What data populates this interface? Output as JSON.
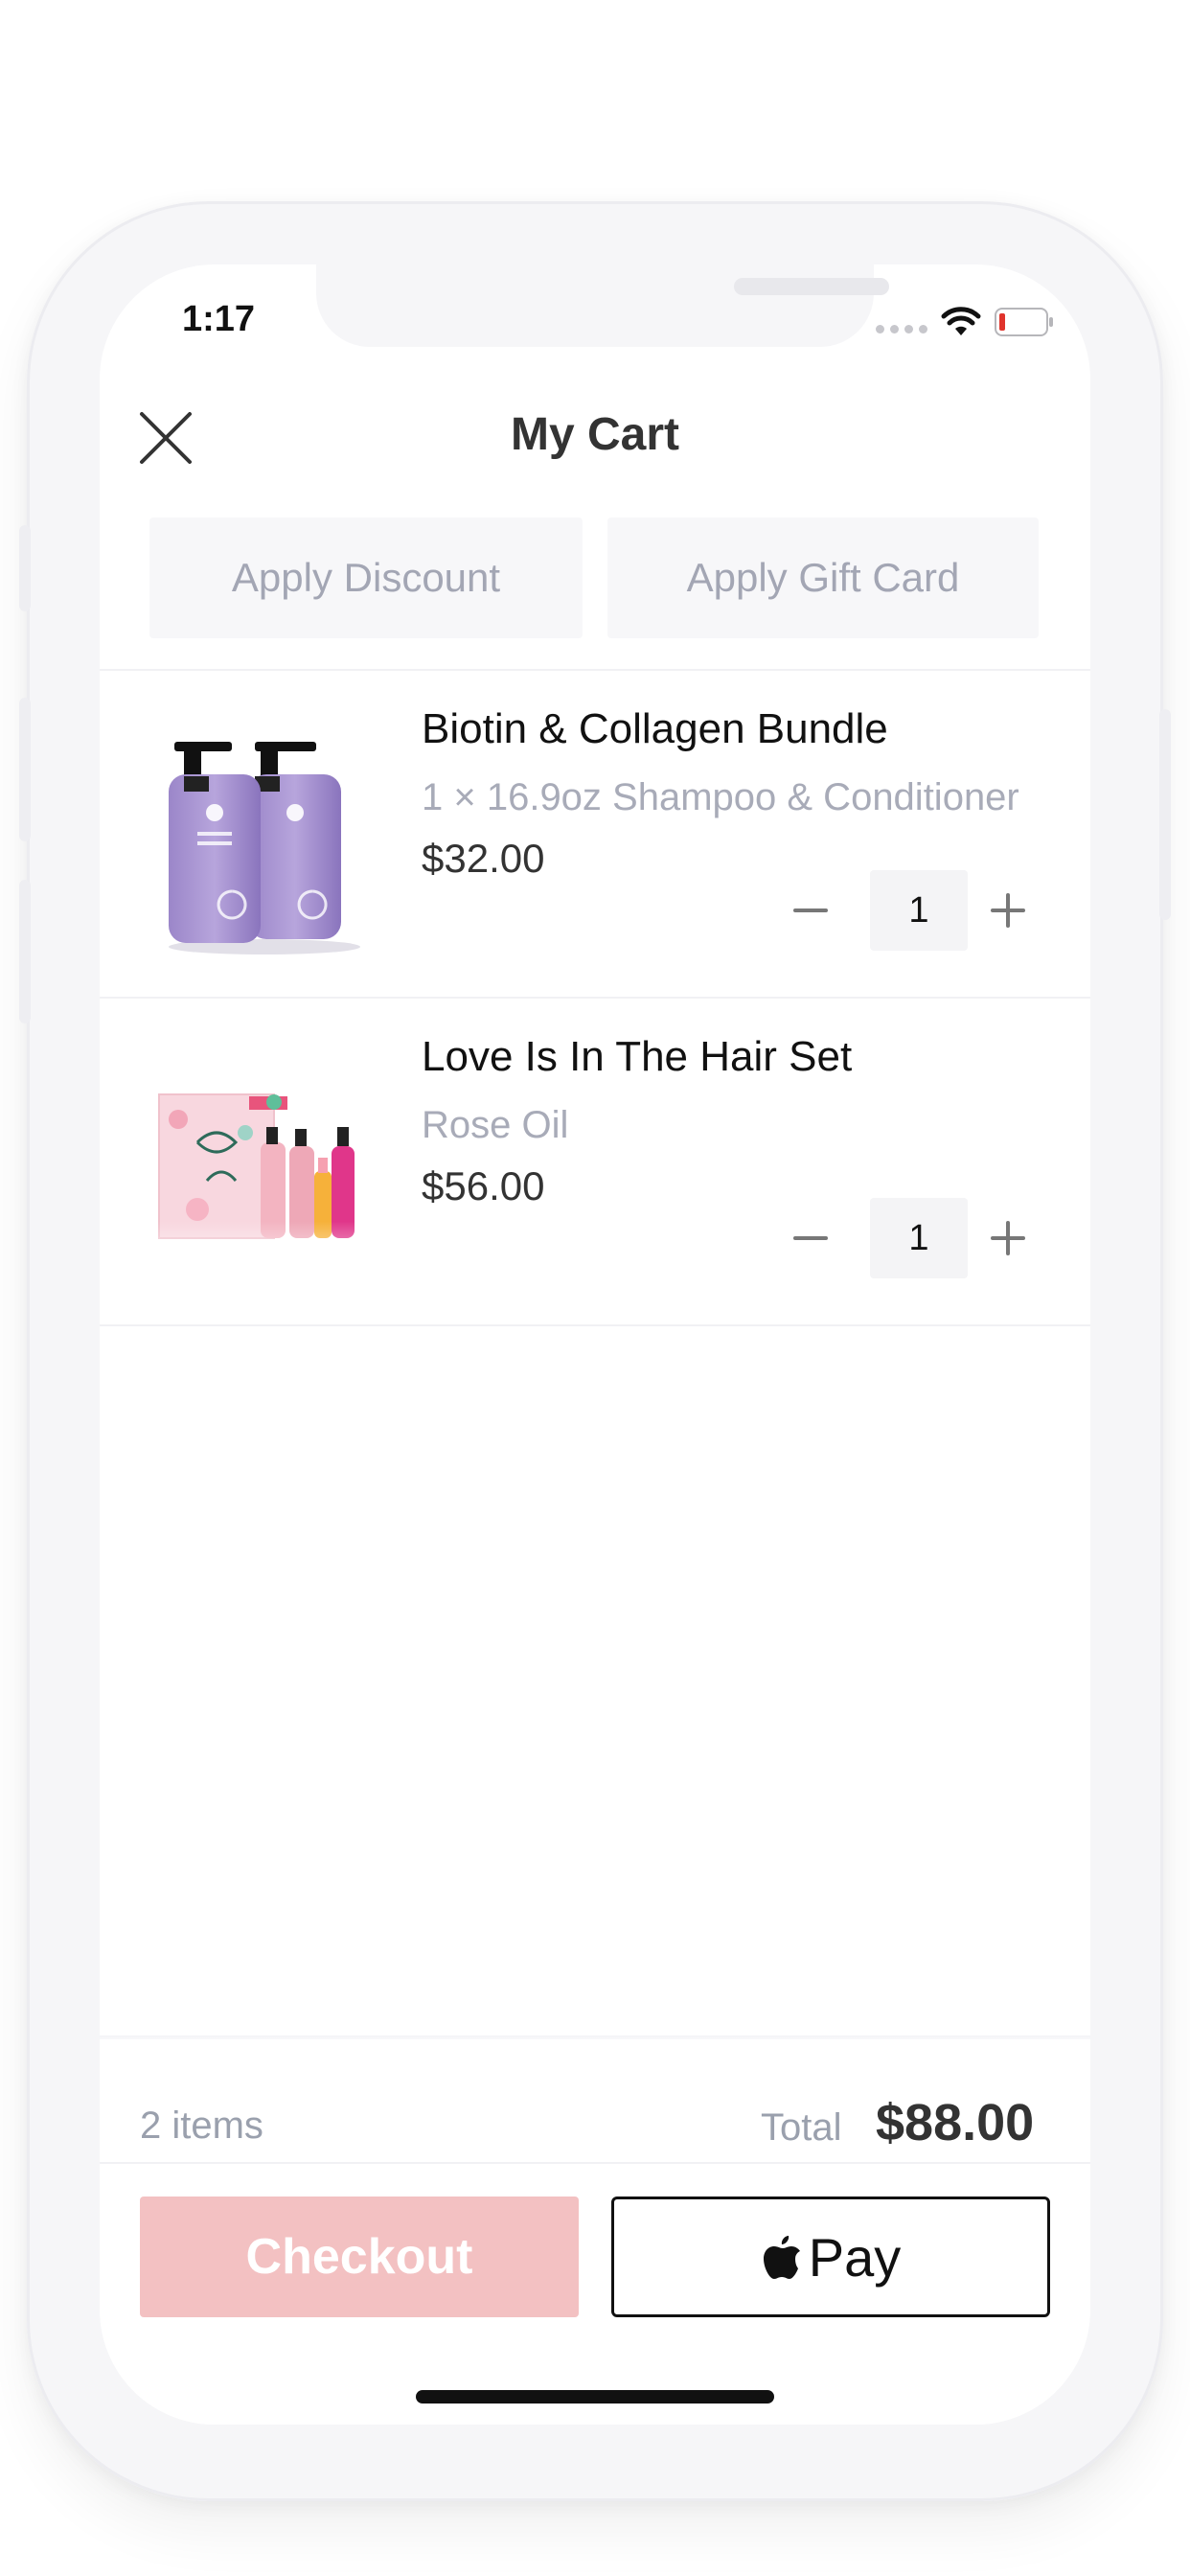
{
  "status_bar": {
    "time": "1:17"
  },
  "header": {
    "title": "My Cart"
  },
  "actions": {
    "apply_discount": "Apply Discount",
    "apply_gift_card": "Apply Gift Card"
  },
  "cart": {
    "items": [
      {
        "title": "Biotin & Collagen Bundle",
        "subtitle": "1 × 16.9oz Shampoo & Conditioner",
        "price": "$32.00",
        "quantity": "1",
        "image": "purple-bottles-image"
      },
      {
        "title": "Love Is In The Hair Set",
        "subtitle": "Rose Oil",
        "price": "$56.00",
        "quantity": "1",
        "image": "gift-set-image"
      }
    ]
  },
  "summary": {
    "items_count": "2 items",
    "total_label": "Total",
    "total_value": "$88.00"
  },
  "buttons": {
    "checkout": "Checkout",
    "apple_pay": "Pay"
  },
  "colors": {
    "checkout_bg": "#f3c1c2",
    "muted_text": "#a3a6b4",
    "title_text": "#333333"
  }
}
